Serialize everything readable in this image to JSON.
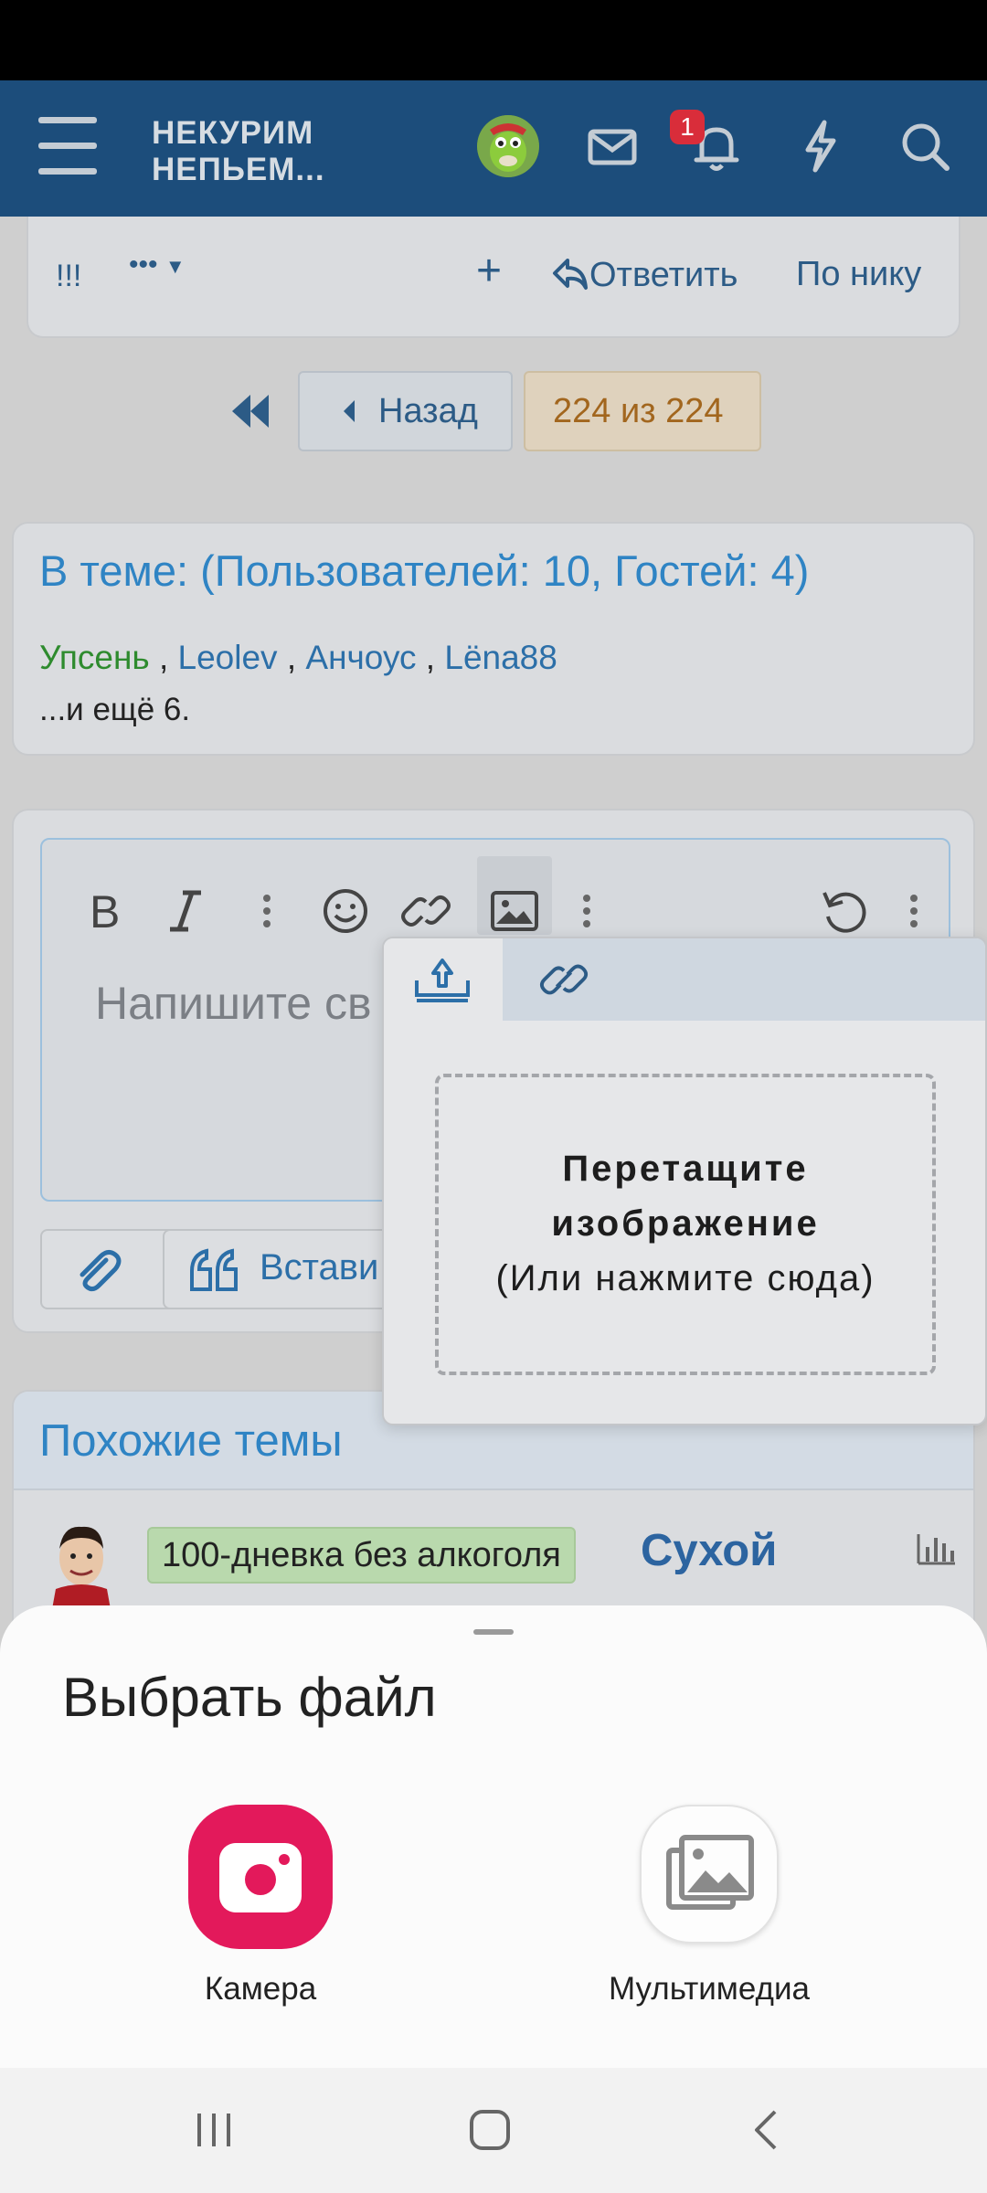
{
  "header": {
    "logo_line1": "НЕКУРИМ",
    "logo_line2": "НЕПЬЕМ...",
    "notification_count": "1",
    "icons": [
      "menu-icon",
      "avatar",
      "mail-icon",
      "bell-icon",
      "lightning-icon",
      "search-icon"
    ],
    "bg_color": "#1c4d7b"
  },
  "post_actions": {
    "exclaim": "!!!",
    "more": "•••",
    "add": "+",
    "reply": "Ответить",
    "by_nick": "По нику"
  },
  "pagination": {
    "back": "Назад",
    "count": "224 из 224"
  },
  "online": {
    "title": "В теме: (Пользователей: 10, Гостей: 4)",
    "users": [
      {
        "name": "Упсень",
        "color": "#2e8b2e"
      },
      {
        "name": "Leolev",
        "color": "#2c6fa8"
      },
      {
        "name": "Анчоус",
        "color": "#2c6fa8"
      },
      {
        "name": "Lëna88",
        "color": "#2c6fa8"
      }
    ],
    "separator": " , ",
    "more": "...и ещё 6."
  },
  "editor": {
    "placeholder": "Напишите св",
    "quote_label": "Встави",
    "toolbar_icons": [
      "bold-icon",
      "italic-icon",
      "more-vertical-icon",
      "smiley-icon",
      "link-icon",
      "image-icon",
      "more-vertical-icon",
      "undo-icon",
      "more-vertical-icon"
    ]
  },
  "image_popup": {
    "drop_line1": "Перетащите",
    "drop_line2": "изображение",
    "drop_line3": "(Или нажмите сюда)"
  },
  "similar": {
    "title": "Похожие темы",
    "topic_tag": "100-дневка без алкоголя",
    "topic_title": "Сухой"
  },
  "file_chooser": {
    "title": "Выбрать файл",
    "options": [
      {
        "label": "Камера",
        "icon": "camera-icon",
        "color": "#e3195b"
      },
      {
        "label": "Мультимедиа",
        "icon": "gallery-icon"
      }
    ]
  },
  "nav": {
    "icons": [
      "recent-apps-icon",
      "home-icon",
      "back-icon"
    ]
  }
}
